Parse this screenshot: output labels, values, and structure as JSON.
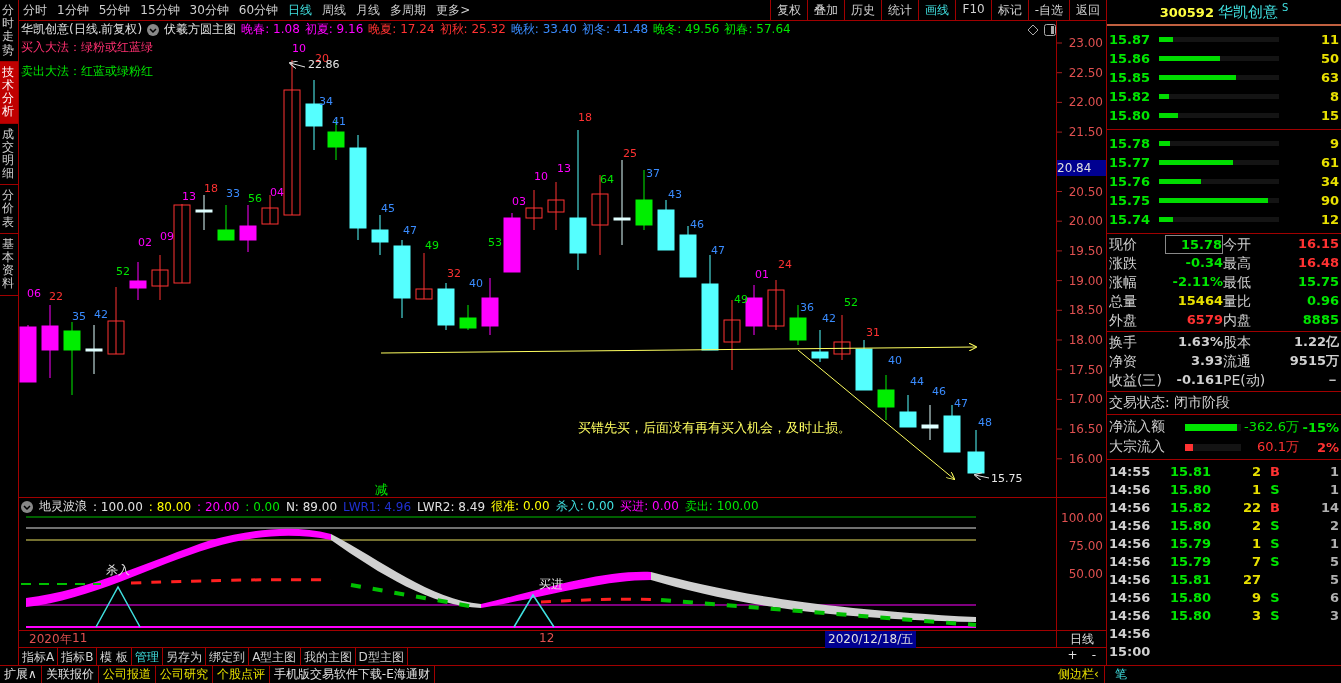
{
  "left_tabs": [
    {
      "label": "分时走势",
      "selected": false
    },
    {
      "label": "技术分析",
      "selected": true
    },
    {
      "label": "成交明细",
      "selected": false
    },
    {
      "label": "分价表",
      "selected": false
    },
    {
      "label": "基本资料",
      "selected": false
    }
  ],
  "toolbar": {
    "periods": [
      {
        "label": "分时",
        "selected": false
      },
      {
        "label": "1分钟",
        "selected": false
      },
      {
        "label": "5分钟",
        "selected": false
      },
      {
        "label": "15分钟",
        "selected": false
      },
      {
        "label": "30分钟",
        "selected": false
      },
      {
        "label": "60分钟",
        "selected": false
      },
      {
        "label": "日线",
        "selected": true
      },
      {
        "label": "周线",
        "selected": false
      },
      {
        "label": "月线",
        "selected": false
      },
      {
        "label": "多周期",
        "selected": false
      },
      {
        "label": "更多>",
        "selected": false
      }
    ],
    "buttons": [
      {
        "label": "复权",
        "selected": false
      },
      {
        "label": "叠加",
        "selected": false
      },
      {
        "label": "历史",
        "selected": false
      },
      {
        "label": "统计",
        "selected": false
      },
      {
        "label": "画线",
        "selected": true
      },
      {
        "label": "F10",
        "selected": false
      },
      {
        "label": "标记",
        "selected": false
      },
      {
        "label": "-自选",
        "selected": false
      },
      {
        "label": "返回",
        "selected": false
      }
    ]
  },
  "chart": {
    "title": "华凯创意(日线.前复权)",
    "indicator": "伏羲方圆主图",
    "params": [
      {
        "text": "晚春: 1.08",
        "color": "#ff00ff"
      },
      {
        "text": "初夏: 9.16",
        "color": "#ff00ff"
      },
      {
        "text": "晚夏: 17.24",
        "color": "#ff3232"
      },
      {
        "text": "初秋: 25.32",
        "color": "#ff3232"
      },
      {
        "text": "晚秋: 33.40",
        "color": "#3a8cff"
      },
      {
        "text": "初冬: 41.48",
        "color": "#3a8cff"
      },
      {
        "text": "晚冬: 49.56",
        "color": "#00e600"
      },
      {
        "text": "初春: 57.64",
        "color": "#00e600"
      }
    ],
    "buy_rule": "买入大法：绿粉或红蓝绿",
    "sell_rule": "卖出大法：红蓝或绿粉红",
    "candle_labels": [
      {
        "text": "06",
        "color": "#ff00ff"
      },
      {
        "text": "22",
        "color": "#ff3232"
      },
      {
        "text": "35",
        "color": "#3a8cff"
      },
      {
        "text": "42",
        "color": "#3a8cff"
      },
      {
        "text": "52",
        "color": "#00e600"
      },
      {
        "text": "02",
        "color": "#ff00ff"
      },
      {
        "text": "09",
        "color": "#ff00ff"
      },
      {
        "text": "13",
        "color": "#ff00ff"
      },
      {
        "text": "18",
        "color": "#ff3232"
      },
      {
        "text": "33",
        "color": "#3a8cff"
      },
      {
        "text": "56",
        "color": "#00e600"
      },
      {
        "text": "04",
        "color": "#ff00ff"
      },
      {
        "text": "10",
        "color": "#ff00ff"
      },
      {
        "text": "20",
        "color": "#ff3232"
      },
      {
        "text": "34",
        "color": "#3a8cff"
      },
      {
        "text": "41",
        "color": "#3a8cff"
      },
      {
        "text": "45",
        "color": "#3a8cff"
      },
      {
        "text": "47",
        "color": "#3a8cff"
      },
      {
        "text": "49",
        "color": "#00e600"
      },
      {
        "text": "32",
        "color": "#ff3232"
      },
      {
        "text": "40",
        "color": "#3a8cff"
      },
      {
        "text": "53",
        "color": "#00e600"
      },
      {
        "text": "03",
        "color": "#ff00ff"
      },
      {
        "text": "10",
        "color": "#ff00ff"
      },
      {
        "text": "13",
        "color": "#ff00ff"
      },
      {
        "text": "18",
        "color": "#ff3232"
      },
      {
        "text": "64",
        "color": "#00e600"
      },
      {
        "text": "25",
        "color": "#ff3232"
      },
      {
        "text": "37",
        "color": "#3a8cff"
      },
      {
        "text": "43",
        "color": "#3a8cff"
      },
      {
        "text": "46",
        "color": "#3a8cff"
      },
      {
        "text": "47",
        "color": "#3a8cff"
      },
      {
        "text": "49",
        "color": "#00e600"
      },
      {
        "text": "01",
        "color": "#ff00ff"
      },
      {
        "text": "24",
        "color": "#ff3232"
      },
      {
        "text": "36",
        "color": "#3a8cff"
      },
      {
        "text": "42",
        "color": "#3a8cff"
      },
      {
        "text": "52",
        "color": "#00e600"
      },
      {
        "text": "31",
        "color": "#ff3232"
      },
      {
        "text": "40",
        "color": "#3a8cff"
      },
      {
        "text": "44",
        "color": "#3a8cff"
      },
      {
        "text": "46",
        "color": "#3a8cff"
      },
      {
        "text": "47",
        "color": "#3a8cff"
      },
      {
        "text": "48",
        "color": "#3a8cff"
      }
    ],
    "high_marker": "22.86",
    "low_marker": "15.75",
    "note": "买错先买，后面没有再有买入机会，及时止损。",
    "mark": "减",
    "price_ticks": [
      "23.00",
      "22.50",
      "22.00",
      "21.50",
      "20.50",
      "20.00",
      "19.50",
      "19.00",
      "18.50",
      "18.00",
      "17.50",
      "17.00",
      "16.50",
      "16.00"
    ],
    "cursor_price": "20.84"
  },
  "indicator": {
    "name": "地灵波浪",
    "values": [
      {
        "text": ": 100.00",
        "color": "#e0e0e0"
      },
      {
        "text": ": 80.00",
        "color": "#ffff00"
      },
      {
        "text": ": 20.00",
        "color": "#ff00ff"
      },
      {
        "text": ": 0.00",
        "color": "#00e600"
      },
      {
        "text": "N: 89.00",
        "color": "#e0e0e0"
      },
      {
        "text": "LWR1: 4.96",
        "color": "#2030d0"
      },
      {
        "text": "LWR2: 8.49",
        "color": "#e0e0e0"
      },
      {
        "text": "很准: 0.00",
        "color": "#ffff00"
      },
      {
        "text": "杀入: 0.00",
        "color": "#40e0e0"
      },
      {
        "text": "买进: 0.00",
        "color": "#ff00ff"
      },
      {
        "text": "卖出: 100.00",
        "color": "#00e600"
      }
    ],
    "axis": [
      "100.00",
      "75.00",
      "50.00"
    ],
    "sell_signal": "杀入",
    "buy_signal": "买进"
  },
  "date_axis": {
    "year": "2020年",
    "months": [
      "11",
      "12"
    ],
    "cursor_date": "2020/12/18/五",
    "period_button": "日线"
  },
  "bottom_tabs": [
    {
      "label": "指标A",
      "selected": false
    },
    {
      "label": "指标B",
      "selected": false
    },
    {
      "label": "模 板",
      "selected": false
    },
    {
      "label": "管理",
      "selected": true
    },
    {
      "label": "另存为",
      "selected": false
    },
    {
      "label": "绑定到",
      "selected": false
    },
    {
      "label": "A型主图",
      "selected": false
    },
    {
      "label": "我的主图",
      "selected": false
    },
    {
      "label": "D型主图",
      "selected": false
    }
  ],
  "zoom_in": "+",
  "zoom_out": "-",
  "bottom_links": [
    {
      "label": "扩展∧",
      "highlighted": false
    },
    {
      "label": "关联报价",
      "highlighted": false
    },
    {
      "label": "公司报道",
      "highlighted": true
    },
    {
      "label": "公司研究",
      "highlighted": true
    },
    {
      "label": "个股点评",
      "highlighted": true
    },
    {
      "label": "手机版交易软件下载-E海通财",
      "highlighted": false
    }
  ],
  "sidebar_toggle": "侧边栏‹",
  "stock": {
    "code": "300592",
    "name": "华凯创意",
    "tag": "S"
  },
  "asks": [
    {
      "price": "15.87",
      "volume": "11",
      "level": 0.12
    },
    {
      "price": "15.86",
      "volume": "50",
      "level": 0.51
    },
    {
      "price": "15.85",
      "volume": "63",
      "level": 0.64
    },
    {
      "price": "15.82",
      "volume": "8",
      "level": 0.08
    },
    {
      "price": "15.80",
      "volume": "15",
      "level": 0.16
    }
  ],
  "bids": [
    {
      "price": "15.78",
      "volume": "9",
      "level": 0.09
    },
    {
      "price": "15.77",
      "volume": "61",
      "level": 0.62
    },
    {
      "price": "15.76",
      "volume": "34",
      "level": 0.35
    },
    {
      "price": "15.75",
      "volume": "90",
      "level": 0.91
    },
    {
      "price": "15.74",
      "volume": "12",
      "level": 0.12
    }
  ],
  "quote": [
    {
      "label": "现价",
      "value": "15.78",
      "color": "#00e600",
      "boxed": true
    },
    {
      "label": "今开",
      "value": "16.15",
      "color": "#ff3232",
      "boxed": false
    },
    {
      "label": "涨跌",
      "value": "-0.34",
      "color": "#00e600",
      "boxed": false
    },
    {
      "label": "最高",
      "value": "16.48",
      "color": "#ff3232",
      "boxed": false
    },
    {
      "label": "涨幅",
      "value": "-2.11%",
      "color": "#00e600",
      "boxed": false
    },
    {
      "label": "最低",
      "value": "15.75",
      "color": "#00e600",
      "boxed": false
    },
    {
      "label": "总量",
      "value": "15464",
      "color": "#e8e000",
      "boxed": false
    },
    {
      "label": "量比",
      "value": "0.96",
      "color": "#00e600",
      "boxed": false
    },
    {
      "label": "外盘",
      "value": "6579",
      "color": "#ff3232",
      "boxed": false
    },
    {
      "label": "内盘",
      "value": "8885",
      "color": "#00e600",
      "boxed": false
    }
  ],
  "fundamentals": [
    {
      "label": "换手",
      "value": "1.63%"
    },
    {
      "label": "股本",
      "value": "1.22亿"
    },
    {
      "label": "净资",
      "value": "3.93"
    },
    {
      "label": "流通",
      "value": "9515万"
    },
    {
      "label": "收益(三)",
      "value": "-0.161"
    },
    {
      "label": "PE(动)",
      "value": "－"
    }
  ],
  "trade_status": "交易状态: 闭市阶段",
  "flows": [
    {
      "label": "净流入额",
      "level": 0.92,
      "amount": "-362.6万",
      "percent": "-15%",
      "color": "#00e600"
    },
    {
      "label": "大宗流入",
      "level": 0.15,
      "amount": "60.1万",
      "percent": "2%",
      "color": "#ff3232"
    }
  ],
  "trades": [
    {
      "time": "14:55",
      "price": "15.81",
      "volume": "2",
      "side": "B",
      "count": "1"
    },
    {
      "time": "14:56",
      "price": "15.80",
      "volume": "1",
      "side": "S",
      "count": "1"
    },
    {
      "time": "14:56",
      "price": "15.82",
      "volume": "22",
      "side": "B",
      "count": "14"
    },
    {
      "time": "14:56",
      "price": "15.80",
      "volume": "2",
      "side": "S",
      "count": "2"
    },
    {
      "time": "14:56",
      "price": "15.79",
      "volume": "1",
      "side": "S",
      "count": "1"
    },
    {
      "time": "14:56",
      "price": "15.79",
      "volume": "7",
      "side": "S",
      "count": "5"
    },
    {
      "time": "14:56",
      "price": "15.81",
      "volume": "27",
      "count": "5"
    },
    {
      "time": "14:56",
      "price": "15.80",
      "volume": "9",
      "side": "S",
      "count": "6"
    },
    {
      "time": "14:56",
      "price": "15.80",
      "volume": "3",
      "side": "S",
      "count": "3"
    },
    {
      "time": "14:56"
    },
    {
      "time": "15:00"
    }
  ],
  "right_tabs": [
    {
      "label": "笔",
      "selected": true
    }
  ]
}
